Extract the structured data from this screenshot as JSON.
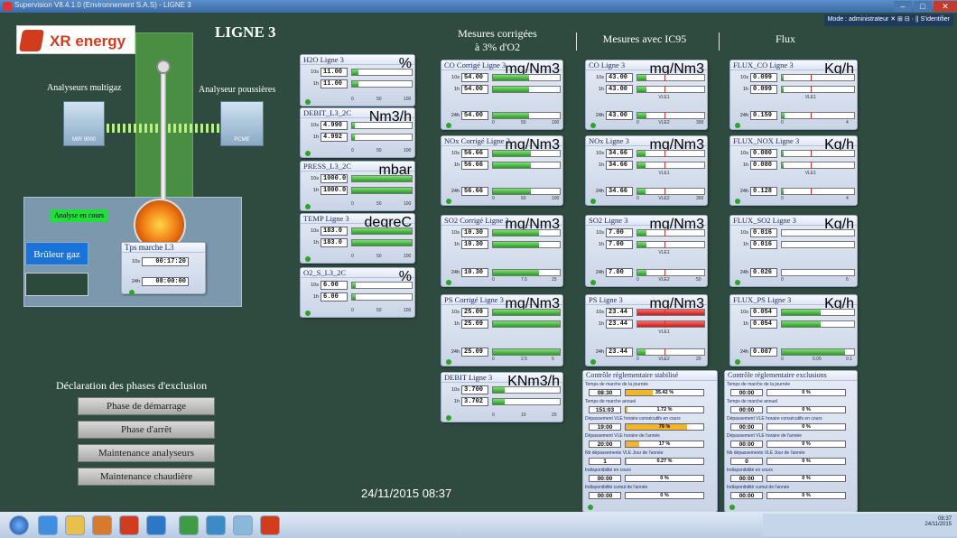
{
  "window": {
    "title": "Supervision V8.4.1.0 (Environnement S.A.S) - LIGNE 3",
    "min": "–",
    "max": "□",
    "close": "✕"
  },
  "toolbar_right": {
    "text": "Mode : administrateur  ✕  ⊞  ⊟  ·  ||  S'identifier"
  },
  "logo": {
    "brand": "XR",
    "word": "energy"
  },
  "title": "LIGNE 3",
  "labels": {
    "multigaz": "Analyseurs multigaz",
    "poussieres": "Analyseur poussières",
    "mir": "MIR 9000",
    "pcme": "PCME"
  },
  "status": {
    "analyse": "Analyse en cours",
    "bruleur": "Brûleur gaz"
  },
  "tps": {
    "title": "Tps marche L3",
    "k1": "10s",
    "v1": "00:17:20",
    "k2": "24h",
    "v2": "08:00:00"
  },
  "sections": {
    "mesures_corr_1": "Mesures corrigées",
    "mesures_corr_2": "à 3% d'O2",
    "ic95": "Mesures avec IC95",
    "flux": "Flux"
  },
  "panels": {
    "h2o": {
      "title": "H2O Ligne 3",
      "unit": "%",
      "r1k": "10s",
      "r1v": "11.00",
      "r2k": "1h",
      "r2v": "11.00",
      "s0": "0",
      "s1": "50",
      "s2": "100",
      "f1": 0.11,
      "f2": 0.11
    },
    "debit": {
      "title": "DEBIT_L3_2C",
      "unit": "Nm3/h",
      "r1k": "10s",
      "r1v": "4.990",
      "r2k": "1h",
      "r2v": "4.992",
      "s0": "0",
      "s1": "50",
      "s2": "100",
      "f1": 0.05,
      "f2": 0.05
    },
    "press": {
      "title": "PRESS_L3_2C",
      "unit": "mbar",
      "r1k": "10s",
      "r1v": "1000.0",
      "r2k": "1h",
      "r2v": "1000.0",
      "s0": "0",
      "s1": "50",
      "s2": "100",
      "f1": 1,
      "f2": 1
    },
    "temp": {
      "title": "TEMP Ligne 3",
      "unit": "degreC",
      "r1k": "10s",
      "r1v": "183.0",
      "r2k": "1h",
      "r2v": "183.0",
      "s0": "0",
      "s1": "50",
      "s2": "100",
      "f1": 1,
      "f2": 1
    },
    "o2": {
      "title": "O2_S_L3_2C",
      "unit": "%",
      "r1k": "10s",
      "r1v": "6.00",
      "r2k": "1h",
      "r2v": "6.00",
      "s0": "0",
      "s1": "50",
      "s2": "100",
      "f1": 0.06,
      "f2": 0.06
    },
    "co_c": {
      "title": "CO Corrigé Ligne 3",
      "unit": "mg/Nm3",
      "r1k": "10s",
      "r1v": "54.00",
      "r2k": "1h",
      "r2v": "54.00",
      "r3k": "24h",
      "r3v": "54.00",
      "s0": "0",
      "s1": "50",
      "s2": "100",
      "f1": 0.54,
      "f2": 0.54,
      "f3": 0.54
    },
    "nox_c": {
      "title": "NOx Corrigé Ligne 3",
      "unit": "mg/Nm3",
      "r1k": "10s",
      "r1v": "56.66",
      "r2k": "1h",
      "r2v": "56.66",
      "r3k": "24h",
      "r3v": "56.66",
      "s0": "0",
      "s1": "50",
      "s2": "100",
      "f1": 0.57,
      "f2": 0.57,
      "f3": 0.57
    },
    "so2_c": {
      "title": "SO2 Corrigé Ligne 3",
      "unit": "mg/Nm3",
      "r1k": "10s",
      "r1v": "10.30",
      "r2k": "1h",
      "r2v": "10.30",
      "r3k": "24h",
      "r3v": "10.30",
      "s0": "0",
      "s1": "7.5",
      "s2": "15",
      "f1": 0.69,
      "f2": 0.69,
      "f3": 0.69
    },
    "ps_c": {
      "title": "PS Corrigé Ligne 3",
      "unit": "mg/Nm3",
      "r1k": "10s",
      "r1v": "25.09",
      "r2k": "1h",
      "r2v": "25.09",
      "r3k": "24h",
      "r3v": "25.09",
      "s0": "0",
      "s1": "2.5",
      "s2": "5",
      "f1": 1,
      "f2": 1,
      "f3": 1
    },
    "debit3": {
      "title": "DEBIT Ligne 3",
      "unit": "KNm3/h",
      "r1k": "10s",
      "r1v": "3.700",
      "r2k": "1h",
      "r2v": "3.702",
      "s0": "0",
      "s1": "10",
      "s2": "20",
      "f1": 0.18,
      "f2": 0.18
    },
    "co_i": {
      "title": "CO Ligne 3",
      "unit": "mg/Nm3",
      "r1k": "10s",
      "r1v": "43.00",
      "r2k": "1h",
      "r2v": "43.00",
      "r3k": "24h",
      "r3v": "43.00",
      "s0": "0",
      "vle1": "VLE1",
      "s2": "300",
      "vle2": "VLE2",
      "f1": 0.14,
      "f2": 0.14,
      "f3": 0.14
    },
    "nox_i": {
      "title": "NOx Ligne 3",
      "unit": "mg/Nm3",
      "r1k": "10s",
      "r1v": "34.66",
      "r2k": "1h",
      "r2v": "34.66",
      "r3k": "24h",
      "r3v": "34.66",
      "s0": "0",
      "vle1": "VLE1",
      "s2": "300",
      "vle2": "VLE2",
      "f1": 0.12,
      "f2": 0.12,
      "f3": 0.12
    },
    "so2_i": {
      "title": "SO2 Ligne 3",
      "unit": "mg/Nm3",
      "r1k": "10s",
      "r1v": "7.00",
      "r2k": "1h",
      "r2v": "7.00",
      "r3k": "24h",
      "r3v": "7.00",
      "s0": "0",
      "vle1": "VLE1",
      "s2": "50",
      "vle2": "VLE2",
      "f1": 0.14,
      "f2": 0.14,
      "f3": 0.14
    },
    "ps_i": {
      "title": "PS Ligne 3",
      "unit": "mg/Nm3",
      "r1k": "10s",
      "r1v": "23.44",
      "r2k": "1h",
      "r2v": "23.44",
      "r3k": "24h",
      "r3v": "23.44",
      "s0": "0",
      "vle1": "VLE1",
      "s2": "20",
      "vle2": "VLE2",
      "f1": 1,
      "f2": 1,
      "f3": 0.12
    },
    "flux_co": {
      "title": "FLUX_CO Ligne 3",
      "unit": "Kg/h",
      "r1k": "10s",
      "r1v": "0.099",
      "r2k": "1h",
      "r2v": "0.099",
      "r3k": "24h",
      "r3v": "0.159",
      "s0": "0",
      "vle1": "VLE1",
      "s2": "4",
      "f1": 0.02,
      "f2": 0.02,
      "f3": 0.04
    },
    "flux_nox": {
      "title": "FLUX_NOX Ligne 3",
      "unit": "Kg/h",
      "r1k": "10s",
      "r1v": "0.080",
      "r2k": "1h",
      "r2v": "0.080",
      "r3k": "24h",
      "r3v": "0.128",
      "s0": "0",
      "vle1": "VLE1",
      "s2": "4",
      "f1": 0.02,
      "f2": 0.02,
      "f3": 0.03
    },
    "flux_so2": {
      "title": "FLUX_SO2 Ligne 3",
      "unit": "Kg/h",
      "r1k": "10s",
      "r1v": "0.016",
      "r2k": "1h",
      "r2v": "0.016",
      "r3k": "24h",
      "r3v": "0.026",
      "s0": "0",
      "s2": "6",
      "f1": 0.003,
      "f2": 0.003,
      "f3": 0.005
    },
    "flux_ps": {
      "title": "FLUX_PS Ligne 3",
      "unit": "Kg/h",
      "r1k": "10s",
      "r1v": "0.054",
      "r2k": "1h",
      "r2v": "0.054",
      "r3k": "24h",
      "r3v": "0.087",
      "s0": "0",
      "s1": "0.05",
      "s2": "0.1",
      "f1": 0.54,
      "f2": 0.54,
      "f3": 0.87
    }
  },
  "ctrl_stab": {
    "title": "Contrôle réglementaire stabilisé",
    "rows": [
      {
        "label": "Temps de marche de la journée",
        "v": "08:30",
        "p": "35.42 %",
        "f": 0.35
      },
      {
        "label": "Temps de marche annuel",
        "v": "151:03",
        "p": "1.72 %",
        "f": 0.02
      },
      {
        "label": "Dépassement VLE horaire consécutifs en cours",
        "v": "19:00",
        "p": "79 %",
        "f": 0.79
      },
      {
        "label": "Dépassement VLE horaire de l'année",
        "v": "20:00",
        "p": "17 %",
        "f": 0.17
      },
      {
        "label": "Nb dépassements VLE Jour de l'année",
        "v": "1",
        "p": "0.27 %",
        "f": 0.003
      },
      {
        "label": "Indisponibilité en cours",
        "v": "00:00",
        "p": "0 %",
        "f": 0
      },
      {
        "label": "Indisponibilité cumul de l'année",
        "v": "00:00",
        "p": "0 %",
        "f": 0
      }
    ]
  },
  "ctrl_excl": {
    "title": "Contrôle réglementaire exclusions",
    "rows": [
      {
        "label": "Temps de marche de la journée",
        "v": "00:00",
        "p": "0 %",
        "f": 0
      },
      {
        "label": "Temps de marche annuel",
        "v": "00:00",
        "p": "0 %",
        "f": 0
      },
      {
        "label": "Dépassement VLE horaire consécutifs en cours",
        "v": "00:00",
        "p": "0 %",
        "f": 0
      },
      {
        "label": "Dépassement VLE horaire de l'année",
        "v": "00:00",
        "p": "0 %",
        "f": 0
      },
      {
        "label": "Nb dépassements VLE Jour de l'année",
        "v": "0",
        "p": "0 %",
        "f": 0
      },
      {
        "label": "Indisponibilité en cours",
        "v": "00:00",
        "p": "0 %",
        "f": 0
      },
      {
        "label": "Indisponibilité cumul de l'année",
        "v": "00:00",
        "p": "0 %",
        "f": 0
      }
    ]
  },
  "exclusion": {
    "title": "Déclaration des phases d'exclusion",
    "b1": "Phase de démarrage",
    "b2": "Phase d'arrêt",
    "b3": "Maintenance analyseurs",
    "b4": "Maintenance chaudière"
  },
  "datetime": "24/11/2015 08:37",
  "tray": {
    "time": "08:37",
    "date": "24/11/2015"
  },
  "colors": {
    "background": "#2f4b40",
    "bar_green": "#2a9a26",
    "bar_red": "#c51b1b",
    "pct_yellow": "#f3b529"
  }
}
